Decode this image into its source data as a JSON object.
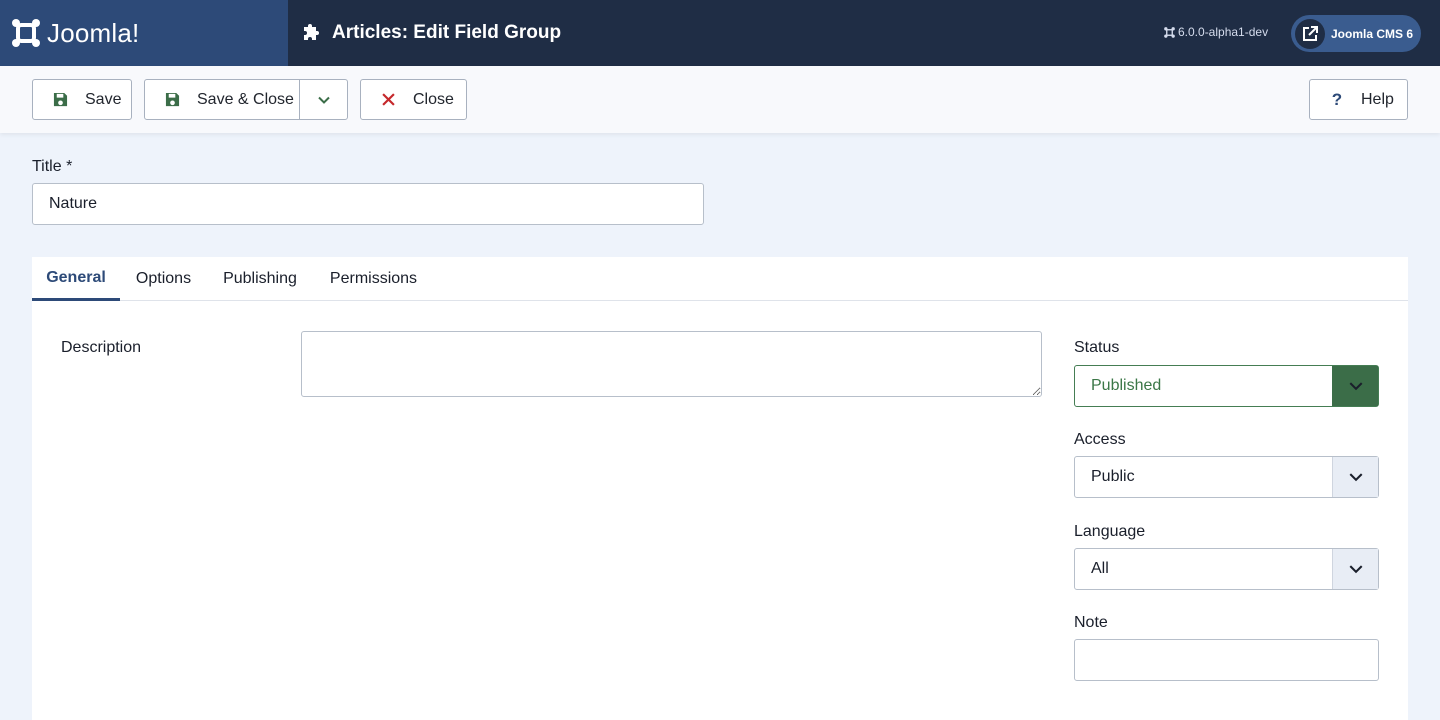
{
  "brand": {
    "name": "Joomla!",
    "logo_icon": "joomla-logo-icon"
  },
  "header": {
    "title": "Articles: Edit Field Group",
    "title_icon": "puzzle-icon",
    "version": "6.0.0-alpha1-dev",
    "site_link_label": "Joomla CMS 6",
    "site_link_icon": "external-link-icon"
  },
  "toolbar": {
    "save_label": "Save",
    "save_close_label": "Save & Close",
    "close_label": "Close",
    "help_label": "Help",
    "help_glyph": "?"
  },
  "form": {
    "title_label": "Title *",
    "title_value": "Nature"
  },
  "tabs": [
    {
      "label": "General",
      "active": true
    },
    {
      "label": "Options"
    },
    {
      "label": "Publishing"
    },
    {
      "label": "Permissions"
    }
  ],
  "general": {
    "description_label": "Description",
    "description_value": "",
    "status_label": "Status",
    "status_value": "Published",
    "access_label": "Access",
    "access_value": "Public",
    "language_label": "Language",
    "language_value": "All",
    "note_label": "Note",
    "note_value": ""
  },
  "colors": {
    "header_bg": "#1f2d45",
    "brand_bg": "#2d4a78",
    "accent": "#2d4a78",
    "status_green": "#3b6d48",
    "close_red": "#c5282b",
    "save_green": "#3b6d48"
  }
}
